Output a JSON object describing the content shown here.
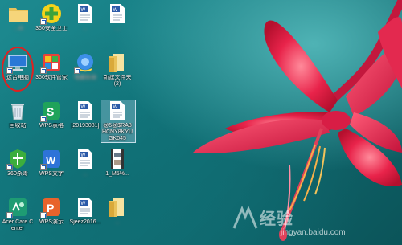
{
  "desktop": {
    "icons": [
      {
        "id": "user-folder",
        "label": "...rk"
      },
      {
        "id": "security-360",
        "label": "360安全卫士"
      },
      {
        "id": "doc-blurred-1",
        "label": "..."
      },
      {
        "id": "doc-blurred-2",
        "label": "...."
      },
      {
        "id": "this-pc",
        "label": "这台电脑"
      },
      {
        "id": "software-360",
        "label": "360软件管家"
      },
      {
        "id": "assistant",
        "label": "电脑管理"
      },
      {
        "id": "new-folder-2",
        "label": "新建文件夹 (2)"
      },
      {
        "id": "recycle-bin",
        "label": "回收站"
      },
      {
        "id": "wps-sheets",
        "label": "WPS表格"
      },
      {
        "id": "doc-20193081",
        "label": "[20193081]"
      },
      {
        "id": "doc-selected",
        "label": "@5@$RA8HCNY8KYUGK045"
      },
      {
        "id": "antivirus-360",
        "label": "360杀毒"
      },
      {
        "id": "wps-writer",
        "label": "WPS文字"
      },
      {
        "id": "doc-blurred-3",
        "label": "..."
      },
      {
        "id": "video-file",
        "label": "1_M5%..."
      },
      {
        "id": "acer-care",
        "label": "Acer Care Center"
      },
      {
        "id": "wps-present",
        "label": "WPS演示"
      },
      {
        "id": "doc-sjeez",
        "label": "Sjeez2016..."
      },
      {
        "id": "folder-blurred",
        "label": "..."
      }
    ]
  },
  "watermark": {
    "brand": "经验",
    "url": "jingyan.baidu.com"
  }
}
